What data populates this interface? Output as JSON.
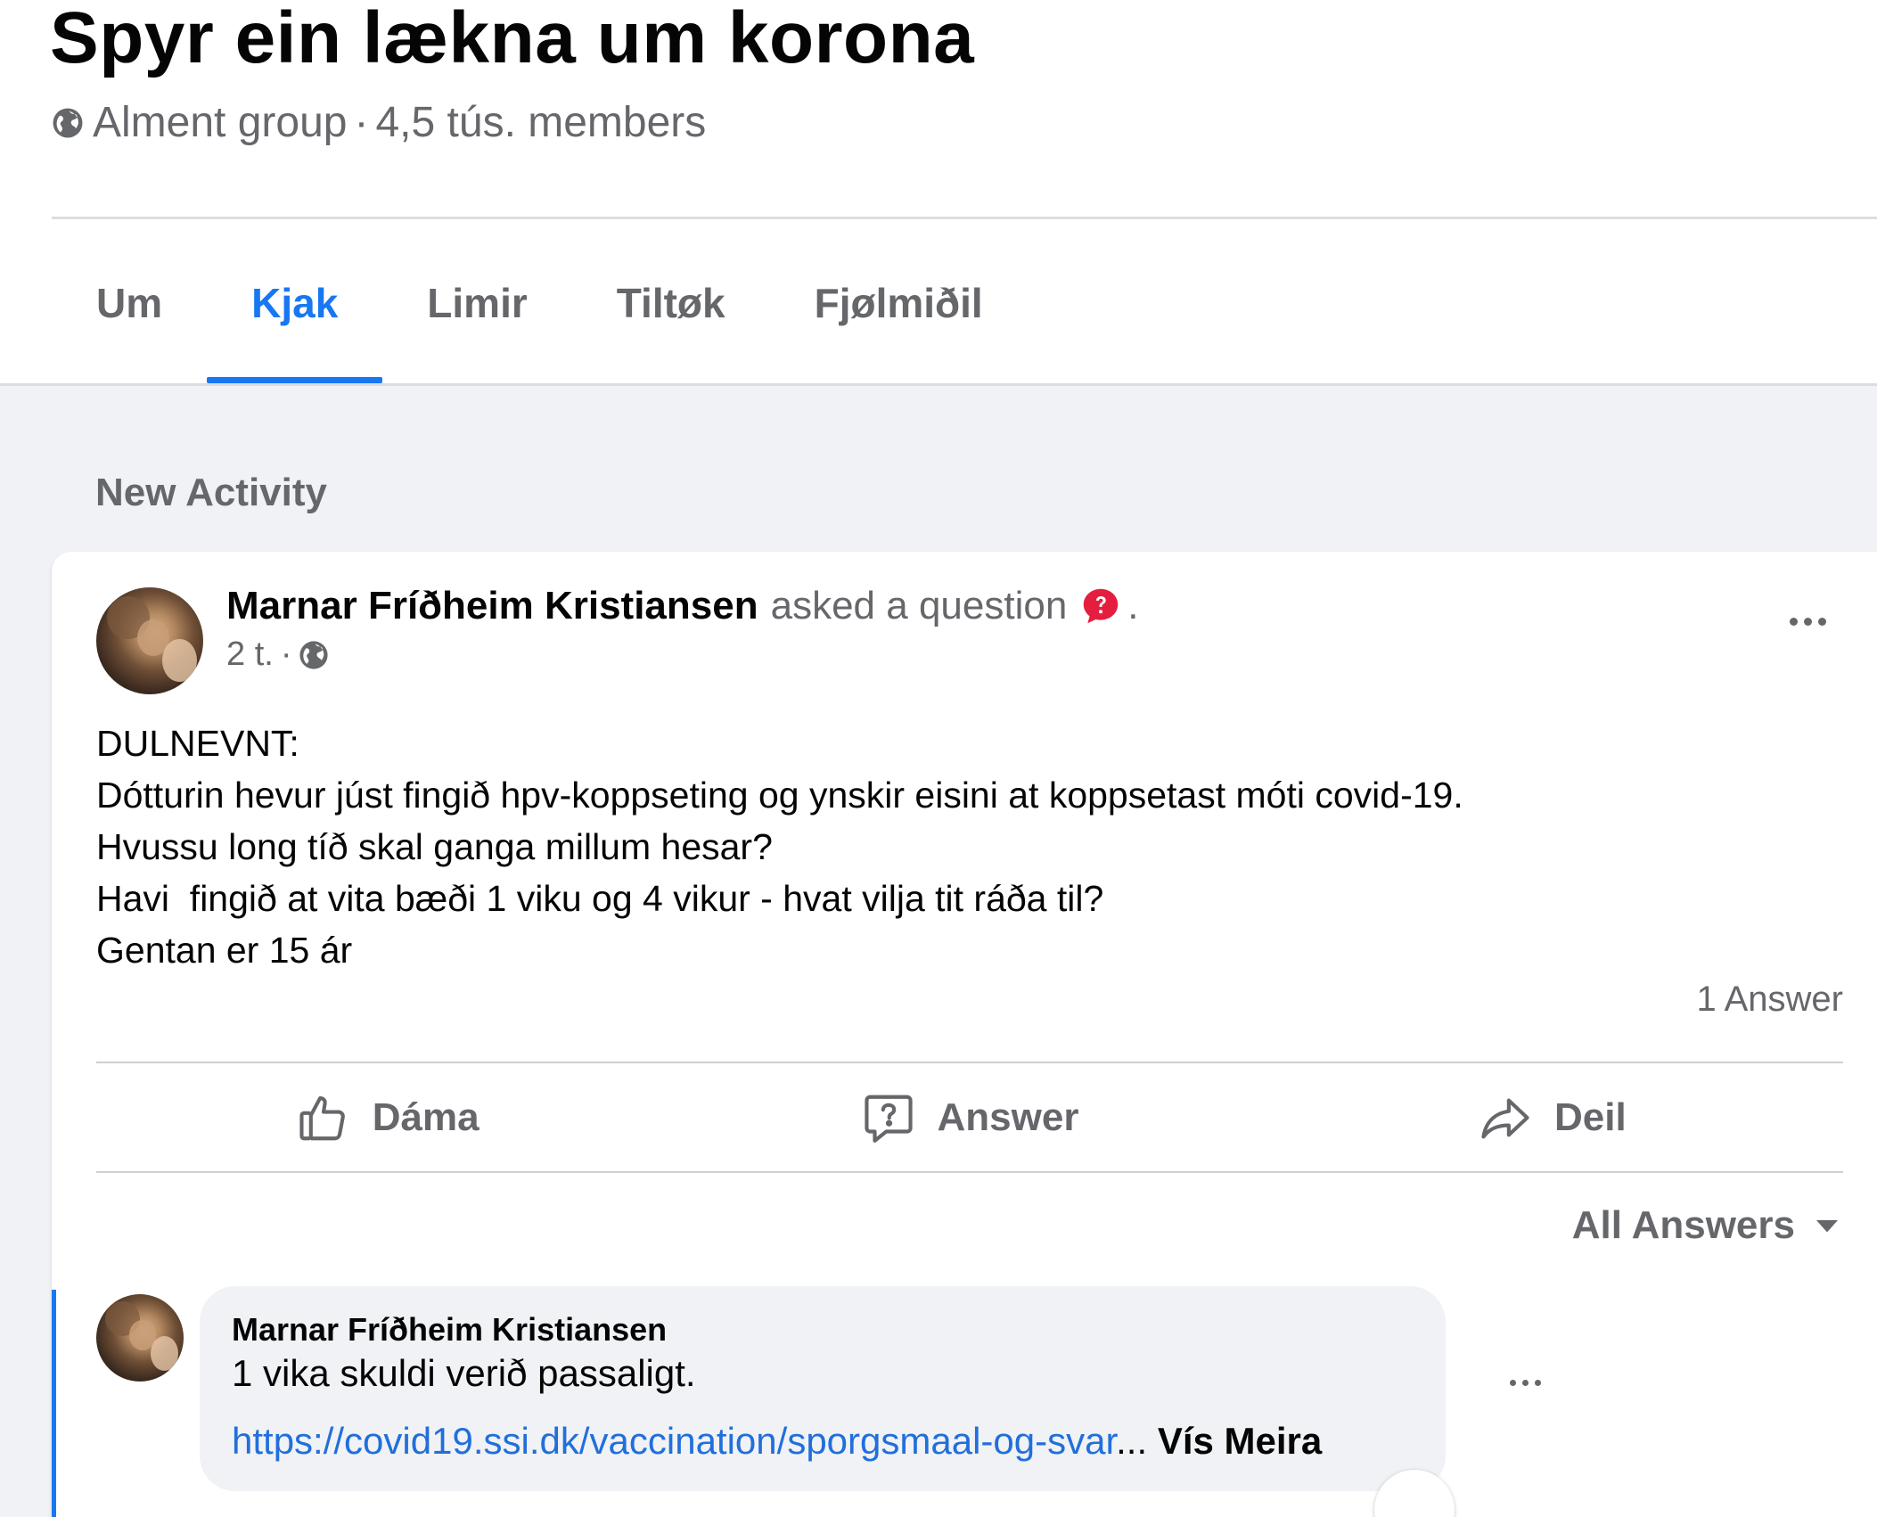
{
  "group": {
    "title": "Spyr ein lækna um korona",
    "privacy": "Alment group",
    "separator": "·",
    "members": "4,5 tús. members",
    "privacy_icon": "globe-icon"
  },
  "tabs": [
    {
      "label": "Um",
      "active": false
    },
    {
      "label": "Kjak",
      "active": true
    },
    {
      "label": "Limir",
      "active": false
    },
    {
      "label": "Tiltøk",
      "active": false
    },
    {
      "label": "Fjølmiðil",
      "active": false
    }
  ],
  "feed": {
    "section_label": "New Activity"
  },
  "post": {
    "author": "Marnar Fríðheim Kristiansen",
    "action": "asked a question",
    "action_icon": "question-badge-icon",
    "trailing": ".",
    "time": "2 t.",
    "time_separator": "·",
    "body_lines": [
      "DULNEVNT:",
      "Dótturin hevur júst fingið hpv-koppseting og ynskir eisini at koppsetast móti covid-19.",
      "Hvussu long tíð skal ganga millum hesar?",
      "Havi  fingið at vita bæði 1 viku og 4 vikur - hvat vilja tit ráða til?",
      "Gentan er 15 ár"
    ],
    "answer_count": "1 Answer",
    "actions": {
      "like": "Dáma",
      "answer": "Answer",
      "share": "Deil"
    },
    "filter_label": "All Answers"
  },
  "answer": {
    "author": "Marnar Fríðheim Kristiansen",
    "text": "1 vika skuldi verið passaligt.",
    "link": "https://covid19.ssi.dk/vaccination/sporgsmaal-og-svar",
    "ellipsis": "...",
    "see_more": " Vís Meira"
  },
  "colors": {
    "accent": "#1877f2",
    "link": "#216fdb",
    "secondary_text": "#65676b",
    "feed_background": "#f0f2f5",
    "question_badge": "#e41e3f"
  }
}
